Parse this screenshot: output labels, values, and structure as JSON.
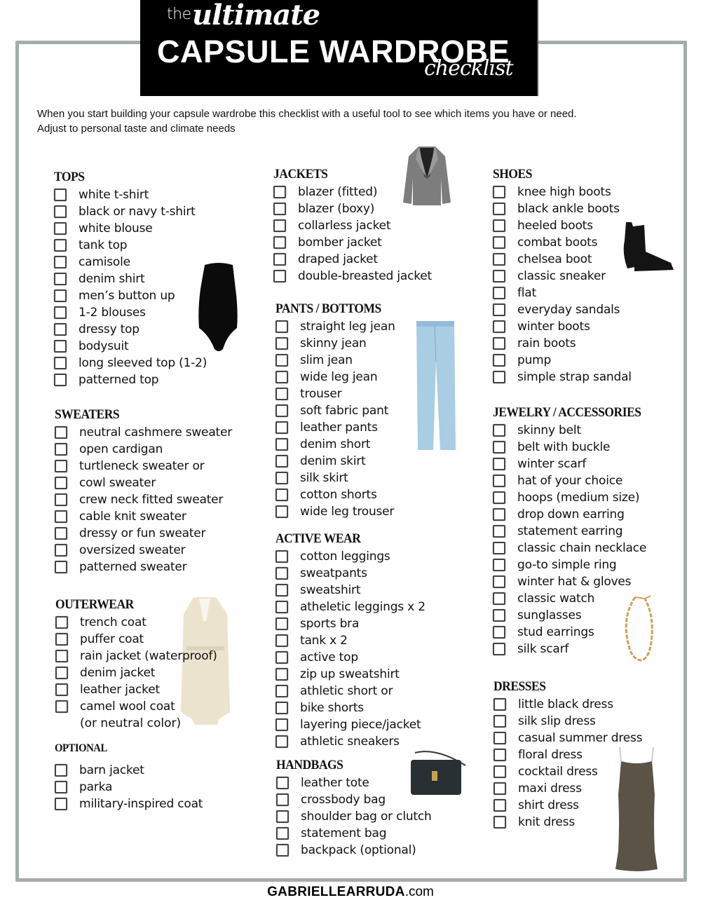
{
  "header": {
    "the": "the",
    "ultimate": "ultimate",
    "main": "CAPSULE WARDROBE",
    "checklist": "checklist"
  },
  "intro": {
    "line1": "When you start building your capsule wardrobe this checklist with a useful tool to see which items you have or need.",
    "line2": "Adjust to personal taste and climate  needs"
  },
  "sections": {
    "tops": {
      "title": "TOPS",
      "items": [
        "white t-shirt",
        "black or navy t-shirt",
        "white blouse",
        "tank top",
        "camisole",
        "denim shirt",
        "men’s button up",
        "1-2 blouses",
        "dressy top",
        "bodysuit",
        "long sleeved top (1-2)",
        "patterned top"
      ]
    },
    "sweaters": {
      "title": "SWEATERS",
      "items": [
        "neutral cashmere sweater",
        "open cardigan",
        "turtleneck sweater or",
        "cowl sweater",
        "crew neck fitted sweater",
        "cable knit sweater",
        "dressy or fun sweater",
        "oversized sweater",
        "patterned sweater"
      ]
    },
    "outerwear": {
      "title": "OUTERWEAR",
      "items": [
        "trench coat",
        "puffer coat",
        "rain jacket (waterproof)",
        "denim jacket",
        "leather jacket",
        "camel wool coat"
      ],
      "continuation": "(or neutral color)"
    },
    "optional": {
      "title": "OPTIONAL",
      "items": [
        "barn jacket",
        "parka",
        "military-inspired coat"
      ]
    },
    "jackets": {
      "title": "JACKETS",
      "items": [
        "blazer (fitted)",
        "blazer (boxy)",
        "collarless jacket",
        "bomber jacket",
        "draped jacket",
        "double-breasted jacket"
      ]
    },
    "pants": {
      "title": "PANTS / BOTTOMS",
      "items": [
        "straight leg jean",
        "skinny jean",
        "slim jean",
        "wide leg jean",
        "trouser",
        "soft fabric pant",
        "leather pants",
        "denim short",
        "denim skirt",
        "silk skirt",
        "cotton shorts",
        "wide leg trouser"
      ]
    },
    "active": {
      "title": "ACTIVE WEAR",
      "items": [
        "cotton leggings",
        "sweatpants",
        "sweatshirt",
        "atheletic leggings x 2",
        "sports bra",
        "tank x 2",
        "active top",
        "zip up sweatshirt",
        "athletic short or",
        "bike shorts",
        "layering piece/jacket",
        "athletic sneakers"
      ]
    },
    "handbags": {
      "title": "HANDBAGS",
      "items": [
        "leather tote",
        "crossbody bag",
        "shoulder bag or clutch",
        "statement bag",
        "backpack (optional)"
      ]
    },
    "shoes": {
      "title": "SHOES",
      "items": [
        "knee high boots",
        "black ankle boots",
        "heeled boots",
        "combat boots",
        "chelsea boot",
        "classic sneaker",
        "flat",
        "everyday sandals",
        "winter boots",
        "rain boots",
        "pump",
        "simple strap sandal"
      ]
    },
    "jewelry": {
      "title": "JEWELRY / ACCESSORIES",
      "items": [
        "skinny belt",
        "belt with buckle",
        "winter scarf",
        "hat of your choice",
        "hoops (medium size)",
        "drop down earring",
        "statement earring",
        "classic chain necklace",
        "go-to simple ring",
        "winter hat & gloves",
        "classic watch",
        "sunglasses",
        "stud earrings",
        "silk scarf"
      ]
    },
    "dresses": {
      "title": "DRESSES",
      "items": [
        "little black dress",
        "silk slip dress",
        "casual summer dress",
        "floral dress",
        "cocktail dress",
        "maxi dress",
        "shirt dress",
        "knit dress"
      ]
    }
  },
  "images": {
    "bodysuit": "bodysuit-image",
    "blazer": "blazer-image",
    "jeans": "jeans-image",
    "boot": "ankle-boot-image",
    "trench": "trench-coat-image",
    "necklace": "chain-necklace-image",
    "bag": "handbag-image",
    "dress": "slip-dress-image"
  },
  "colors": {
    "frame": "#a3adab",
    "title_bg": "#000000",
    "text": "#111111"
  },
  "footer": {
    "brand": "GABRIELLEARRUDA",
    "suffix": ".com"
  }
}
